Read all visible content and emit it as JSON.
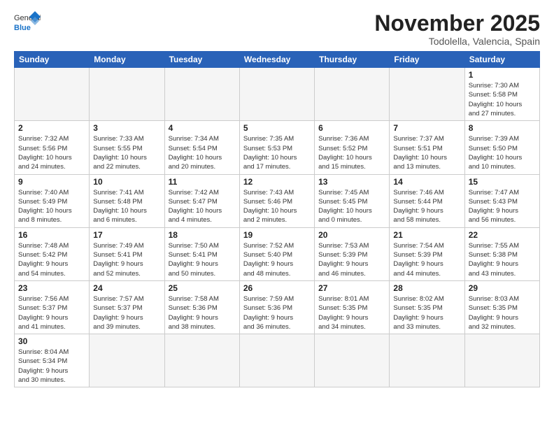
{
  "header": {
    "logo_general": "General",
    "logo_blue": "Blue",
    "month_title": "November 2025",
    "location": "Todolella, Valencia, Spain"
  },
  "weekdays": [
    "Sunday",
    "Monday",
    "Tuesday",
    "Wednesday",
    "Thursday",
    "Friday",
    "Saturday"
  ],
  "weeks": [
    [
      {
        "day": "",
        "info": ""
      },
      {
        "day": "",
        "info": ""
      },
      {
        "day": "",
        "info": ""
      },
      {
        "day": "",
        "info": ""
      },
      {
        "day": "",
        "info": ""
      },
      {
        "day": "",
        "info": ""
      },
      {
        "day": "1",
        "info": "Sunrise: 7:30 AM\nSunset: 5:58 PM\nDaylight: 10 hours\nand 27 minutes."
      }
    ],
    [
      {
        "day": "2",
        "info": "Sunrise: 7:32 AM\nSunset: 5:56 PM\nDaylight: 10 hours\nand 24 minutes."
      },
      {
        "day": "3",
        "info": "Sunrise: 7:33 AM\nSunset: 5:55 PM\nDaylight: 10 hours\nand 22 minutes."
      },
      {
        "day": "4",
        "info": "Sunrise: 7:34 AM\nSunset: 5:54 PM\nDaylight: 10 hours\nand 20 minutes."
      },
      {
        "day": "5",
        "info": "Sunrise: 7:35 AM\nSunset: 5:53 PM\nDaylight: 10 hours\nand 17 minutes."
      },
      {
        "day": "6",
        "info": "Sunrise: 7:36 AM\nSunset: 5:52 PM\nDaylight: 10 hours\nand 15 minutes."
      },
      {
        "day": "7",
        "info": "Sunrise: 7:37 AM\nSunset: 5:51 PM\nDaylight: 10 hours\nand 13 minutes."
      },
      {
        "day": "8",
        "info": "Sunrise: 7:39 AM\nSunset: 5:50 PM\nDaylight: 10 hours\nand 10 minutes."
      }
    ],
    [
      {
        "day": "9",
        "info": "Sunrise: 7:40 AM\nSunset: 5:49 PM\nDaylight: 10 hours\nand 8 minutes."
      },
      {
        "day": "10",
        "info": "Sunrise: 7:41 AM\nSunset: 5:48 PM\nDaylight: 10 hours\nand 6 minutes."
      },
      {
        "day": "11",
        "info": "Sunrise: 7:42 AM\nSunset: 5:47 PM\nDaylight: 10 hours\nand 4 minutes."
      },
      {
        "day": "12",
        "info": "Sunrise: 7:43 AM\nSunset: 5:46 PM\nDaylight: 10 hours\nand 2 minutes."
      },
      {
        "day": "13",
        "info": "Sunrise: 7:45 AM\nSunset: 5:45 PM\nDaylight: 10 hours\nand 0 minutes."
      },
      {
        "day": "14",
        "info": "Sunrise: 7:46 AM\nSunset: 5:44 PM\nDaylight: 9 hours\nand 58 minutes."
      },
      {
        "day": "15",
        "info": "Sunrise: 7:47 AM\nSunset: 5:43 PM\nDaylight: 9 hours\nand 56 minutes."
      }
    ],
    [
      {
        "day": "16",
        "info": "Sunrise: 7:48 AM\nSunset: 5:42 PM\nDaylight: 9 hours\nand 54 minutes."
      },
      {
        "day": "17",
        "info": "Sunrise: 7:49 AM\nSunset: 5:41 PM\nDaylight: 9 hours\nand 52 minutes."
      },
      {
        "day": "18",
        "info": "Sunrise: 7:50 AM\nSunset: 5:41 PM\nDaylight: 9 hours\nand 50 minutes."
      },
      {
        "day": "19",
        "info": "Sunrise: 7:52 AM\nSunset: 5:40 PM\nDaylight: 9 hours\nand 48 minutes."
      },
      {
        "day": "20",
        "info": "Sunrise: 7:53 AM\nSunset: 5:39 PM\nDaylight: 9 hours\nand 46 minutes."
      },
      {
        "day": "21",
        "info": "Sunrise: 7:54 AM\nSunset: 5:39 PM\nDaylight: 9 hours\nand 44 minutes."
      },
      {
        "day": "22",
        "info": "Sunrise: 7:55 AM\nSunset: 5:38 PM\nDaylight: 9 hours\nand 43 minutes."
      }
    ],
    [
      {
        "day": "23",
        "info": "Sunrise: 7:56 AM\nSunset: 5:37 PM\nDaylight: 9 hours\nand 41 minutes."
      },
      {
        "day": "24",
        "info": "Sunrise: 7:57 AM\nSunset: 5:37 PM\nDaylight: 9 hours\nand 39 minutes."
      },
      {
        "day": "25",
        "info": "Sunrise: 7:58 AM\nSunset: 5:36 PM\nDaylight: 9 hours\nand 38 minutes."
      },
      {
        "day": "26",
        "info": "Sunrise: 7:59 AM\nSunset: 5:36 PM\nDaylight: 9 hours\nand 36 minutes."
      },
      {
        "day": "27",
        "info": "Sunrise: 8:01 AM\nSunset: 5:35 PM\nDaylight: 9 hours\nand 34 minutes."
      },
      {
        "day": "28",
        "info": "Sunrise: 8:02 AM\nSunset: 5:35 PM\nDaylight: 9 hours\nand 33 minutes."
      },
      {
        "day": "29",
        "info": "Sunrise: 8:03 AM\nSunset: 5:35 PM\nDaylight: 9 hours\nand 32 minutes."
      }
    ],
    [
      {
        "day": "30",
        "info": "Sunrise: 8:04 AM\nSunset: 5:34 PM\nDaylight: 9 hours\nand 30 minutes."
      },
      {
        "day": "",
        "info": ""
      },
      {
        "day": "",
        "info": ""
      },
      {
        "day": "",
        "info": ""
      },
      {
        "day": "",
        "info": ""
      },
      {
        "day": "",
        "info": ""
      },
      {
        "day": "",
        "info": ""
      }
    ]
  ]
}
